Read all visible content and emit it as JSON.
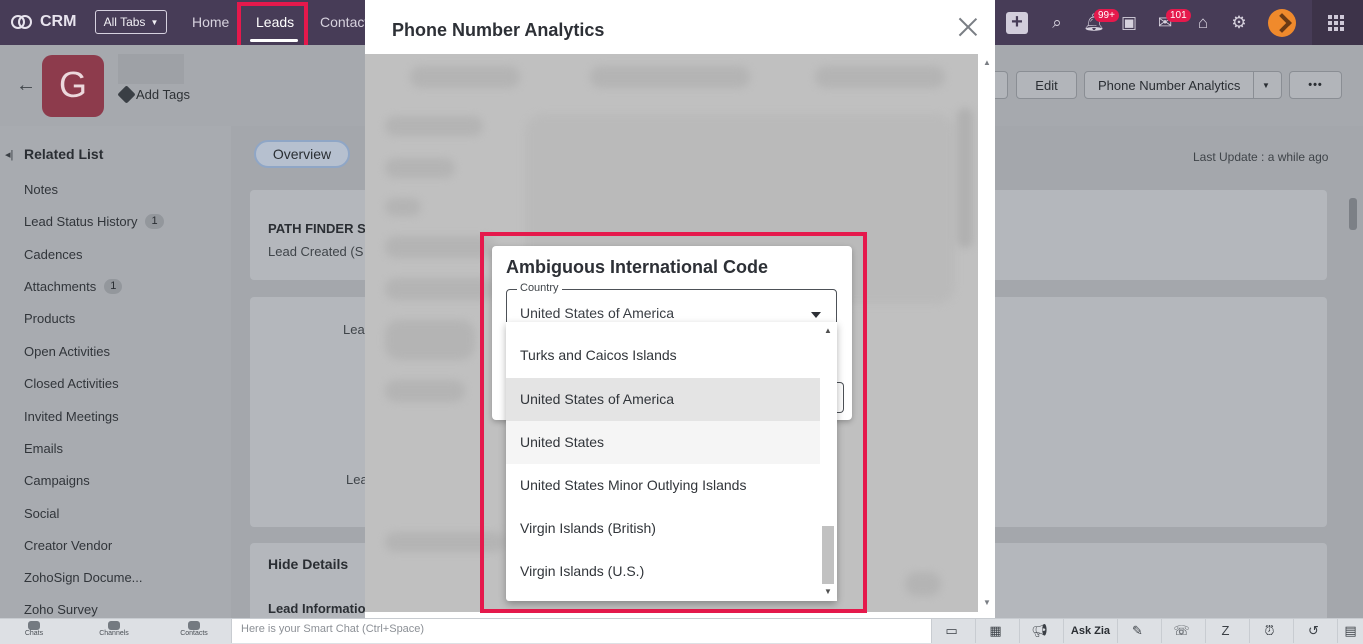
{
  "topbar": {
    "app_name": "CRM",
    "all_tabs_label": "All Tabs",
    "nav": {
      "home": "Home",
      "leads": "Leads",
      "contacts": "Contact"
    },
    "notifications_badge": "99+",
    "mail_badge": "101"
  },
  "record": {
    "avatar_letter": "G",
    "add_tags_label": "Add Tags",
    "edit_label": "Edit",
    "phone_analytics_label": "Phone Number Analytics",
    "more_label": "•••"
  },
  "sidebar": {
    "title": "Related List",
    "items": [
      {
        "label": "Notes",
        "count": ""
      },
      {
        "label": "Lead Status History",
        "count": "1"
      },
      {
        "label": "Cadences",
        "count": ""
      },
      {
        "label": "Attachments",
        "count": "1"
      },
      {
        "label": "Products",
        "count": ""
      },
      {
        "label": "Open Activities",
        "count": ""
      },
      {
        "label": "Closed Activities",
        "count": ""
      },
      {
        "label": "Invited Meetings",
        "count": ""
      },
      {
        "label": "Emails",
        "count": ""
      },
      {
        "label": "Campaigns",
        "count": ""
      },
      {
        "label": "Social",
        "count": ""
      },
      {
        "label": "Creator Vendor",
        "count": ""
      },
      {
        "label": "ZohoSign Docume...",
        "count": ""
      },
      {
        "label": "Zoho Survey",
        "count": ""
      }
    ]
  },
  "main": {
    "overview_tab": "Overview",
    "last_update": "Last Update : a while ago",
    "path_finder": "PATH FINDER S",
    "lead_created": "Lead Created  (S",
    "lea_1": "Lea",
    "lea_2": "Lea",
    "hide_details": "Hide Details",
    "lead_information": "Lead Information"
  },
  "modal": {
    "title": "Phone Number Analytics"
  },
  "dialog": {
    "title": "Ambiguous International Code",
    "field_label": "Country",
    "selected_value": "United States of America",
    "options": [
      "Turks and Caicos Islands",
      "United States of America",
      "United States",
      "United States Minor Outlying Islands",
      "Virgin Islands (British)",
      "Virgin Islands (U.S.)"
    ]
  },
  "bottombar": {
    "chats": "Chats",
    "channels": "Channels",
    "contacts": "Contacts",
    "smart_chat_placeholder": "Here is your Smart Chat (Ctrl+Space)",
    "ask_zia": "Ask Zia"
  },
  "colors": {
    "nav_bg": "#473c57",
    "highlight": "#e5194c",
    "selected_option": "#e4e4e4"
  }
}
